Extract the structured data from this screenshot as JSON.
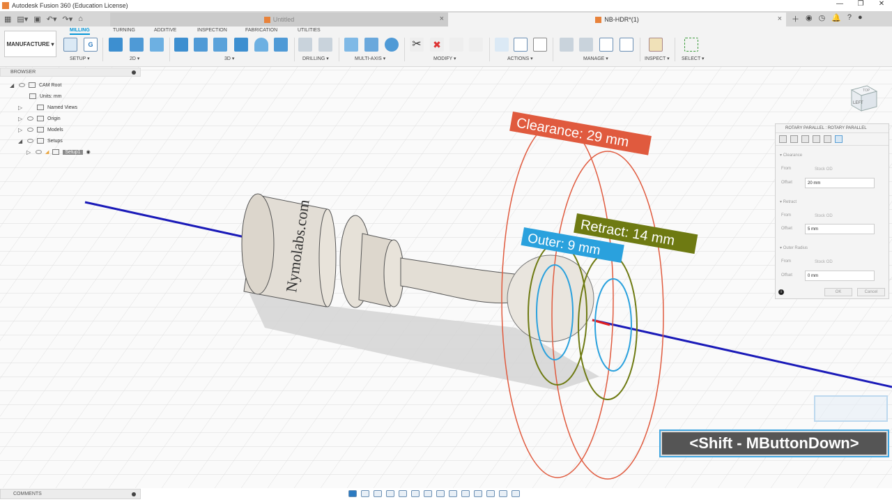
{
  "window": {
    "title": "Autodesk Fusion 360 (Education License)"
  },
  "tabs": {
    "untitled": "Untitled",
    "active": "NB-HDR*(1)"
  },
  "ribbon": {
    "workspace": "MANUFACTURE",
    "tabs": [
      "MILLING",
      "TURNING",
      "ADDITIVE",
      "INSPECTION",
      "FABRICATION",
      "UTILITIES"
    ],
    "groups": [
      "SETUP",
      "2D",
      "3D",
      "DRILLING",
      "MULTI-AXIS",
      "MODIFY",
      "ACTIONS",
      "MANAGE",
      "INSPECT",
      "SELECT"
    ],
    "icon_g": "G"
  },
  "browser": {
    "header": "BROWSER",
    "items": [
      "CAM Root",
      "Units: mm",
      "Named Views",
      "Origin",
      "Models",
      "Setups",
      "Setup1"
    ]
  },
  "panel": {
    "title": "ROTARY PARALLEL : ROTARY PARALLEL",
    "sections": {
      "clearance": "Clearance",
      "retract": "Retract",
      "outer": "Outer Radius"
    },
    "from_label": "From",
    "offset_label": "Offset",
    "from_value": "Stock OD",
    "clearance_offset": "20 mm",
    "retract_offset": "5 mm",
    "outer_offset": "0 mm",
    "ok": "OK",
    "cancel": "Cancel",
    "info": "i"
  },
  "viewport": {
    "model_text": "Nymolabs.com",
    "clearance_label": "Clearance: 29 mm",
    "retract_label": "Retract: 14 mm",
    "outer_label": "Outer: 9 mm",
    "viewcube_face": "LEFT",
    "viewcube_top": "TOP",
    "shortcut": "<Shift - MButtonDown>",
    "colors": {
      "clearance": "#e05a3e",
      "retract": "#6e7a12",
      "outer": "#2aa1dd",
      "axis": "#1a1ab8"
    }
  },
  "comments": {
    "label": "COMMENTS"
  }
}
